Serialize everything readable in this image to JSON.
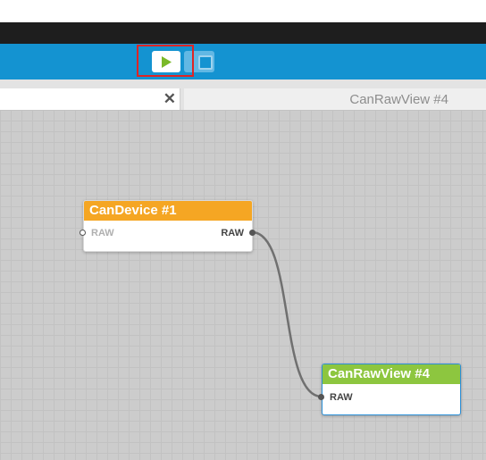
{
  "toolbar": {
    "play_icon": "play-icon",
    "stop_icon": "stop-icon",
    "accent": "#1493d1"
  },
  "tabs": [
    {
      "label": "",
      "close_symbol": "✕"
    },
    {
      "label": "CanRawView #4"
    }
  ],
  "nodes": [
    {
      "title": "CanDevice #1",
      "header_color": "#f5a623",
      "input_port": "RAW",
      "output_port": "RAW"
    },
    {
      "title": "CanRawView #4",
      "header_color": "#8dc63f",
      "input_port": "RAW"
    }
  ]
}
